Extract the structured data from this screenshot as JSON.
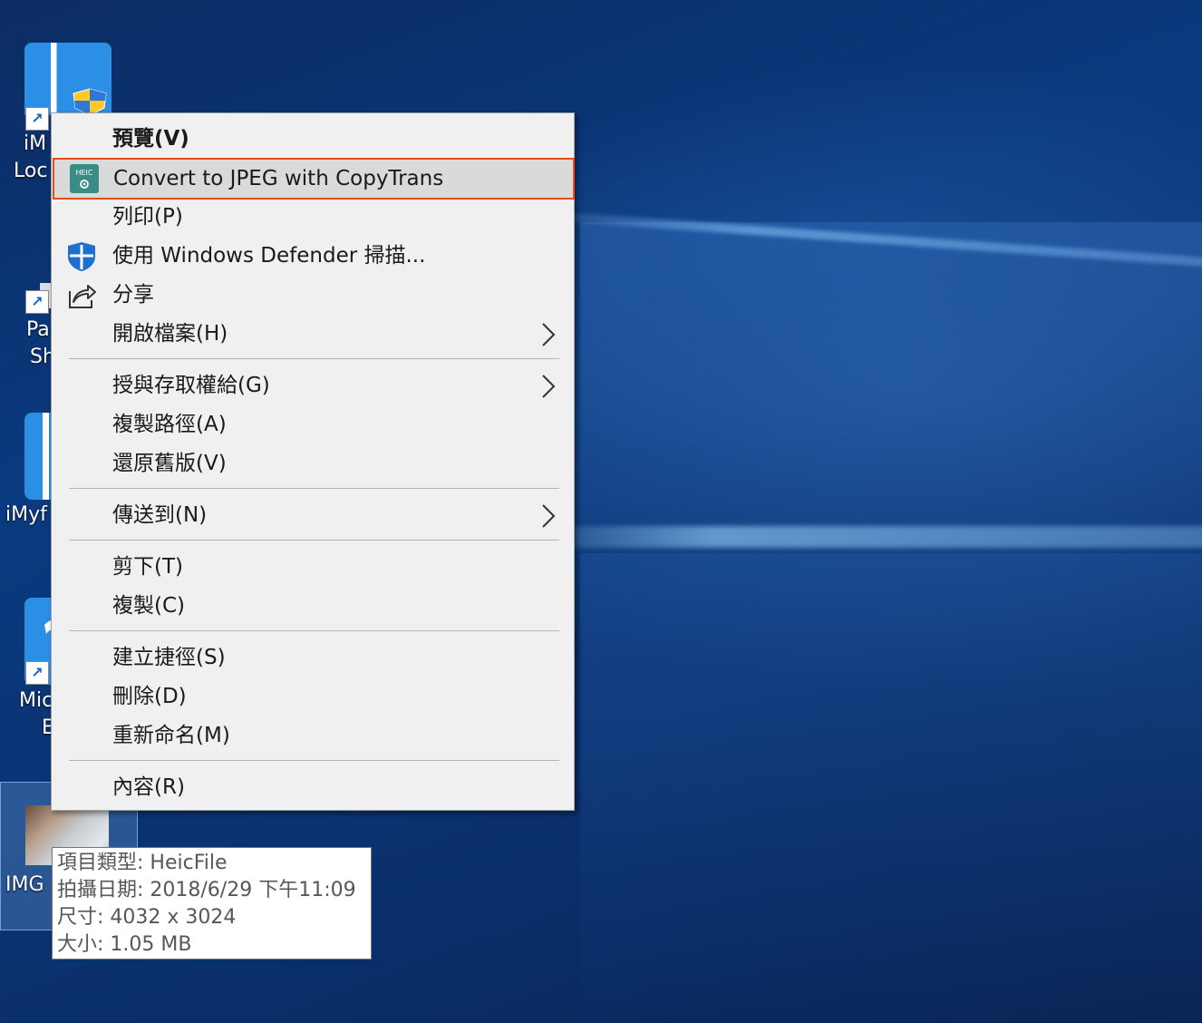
{
  "desktop": {
    "icons": [
      {
        "name": "iMyFone LockWiper",
        "label_visible_1": "iM",
        "label_visible_2": "Loc"
      },
      {
        "name": "PassFab",
        "label_visible_1": "Pa",
        "label_visible_2": "Sh"
      },
      {
        "name": "iMyFone",
        "label_visible_1": "iMyf"
      },
      {
        "name": "Microsoft Edge",
        "label_visible_1": "Mic",
        "label_visible_2": "E"
      }
    ],
    "selected_file_label": "IMG"
  },
  "context_menu": {
    "items": [
      {
        "label": "預覽(V)",
        "bold": true,
        "icon": ""
      },
      {
        "label": "Convert to JPEG with CopyTrans",
        "icon": "heic-converter-icon",
        "icon_text": "HEIC",
        "highlighted": true
      },
      {
        "label": "列印(P)",
        "icon": ""
      },
      {
        "label": "使用 Windows Defender 掃描...",
        "icon": "windows-defender-shield-icon"
      },
      {
        "label": "分享",
        "icon": "share-icon"
      },
      {
        "label": "開啟檔案(H)",
        "icon": "",
        "submenu": true
      },
      {
        "label": "授與存取權給(G)",
        "icon": "",
        "submenu": true
      },
      {
        "label": "複製路徑(A)",
        "icon": ""
      },
      {
        "label": "還原舊版(V)",
        "icon": ""
      },
      {
        "label": "傳送到(N)",
        "icon": "",
        "submenu": true
      },
      {
        "label": "剪下(T)",
        "icon": ""
      },
      {
        "label": "複製(C)",
        "icon": ""
      },
      {
        "label": "建立捷徑(S)",
        "icon": ""
      },
      {
        "label": "刪除(D)",
        "icon": ""
      },
      {
        "label": "重新命名(M)",
        "icon": ""
      },
      {
        "label": "內容(R)",
        "icon": ""
      }
    ],
    "highlight_border_color": "#e84c1d"
  },
  "tooltip": {
    "type": "項目類型: HeicFile",
    "date_taken": "拍攝日期: 2018/6/29 下午11:09",
    "dimensions": "尺寸: 4032 x 3024",
    "size": "大小: 1.05 MB"
  }
}
